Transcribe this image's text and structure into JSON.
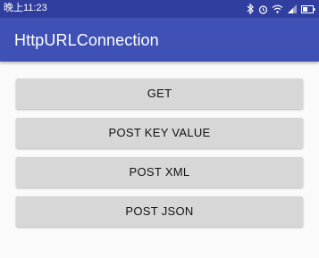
{
  "status_bar": {
    "time": "晚上11:23",
    "battery": "38",
    "icons": [
      "bluetooth-icon",
      "alarm-icon",
      "wifi-icon",
      "signal-icon",
      "battery-icon"
    ]
  },
  "app_bar": {
    "title": "HttpURLConnection",
    "color": "#3f51b5"
  },
  "buttons": [
    {
      "label": "GET"
    },
    {
      "label": "POST KEY VALUE"
    },
    {
      "label": "POST XML"
    },
    {
      "label": "POST JSON"
    }
  ]
}
